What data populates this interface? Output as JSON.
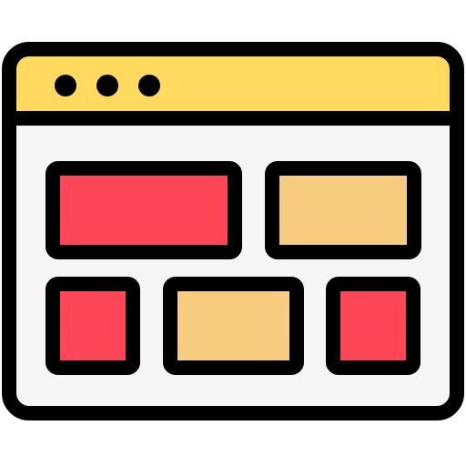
{
  "icon": {
    "name": "browser-window-layout-icon",
    "colors": {
      "outline": "#000000",
      "title_bar": "#FFDA5E",
      "content_bg": "#F6F4F5",
      "tile_red": "#FF4656",
      "tile_tan": "#F8CC7E",
      "window_dots": "#000000"
    },
    "window_dots_count": 3,
    "tiles": [
      {
        "id": "tile-top-left",
        "tone": "red"
      },
      {
        "id": "tile-top-right",
        "tone": "tan"
      },
      {
        "id": "tile-bottom-left",
        "tone": "red"
      },
      {
        "id": "tile-bottom-middle",
        "tone": "tan"
      },
      {
        "id": "tile-bottom-right",
        "tone": "red"
      }
    ]
  }
}
